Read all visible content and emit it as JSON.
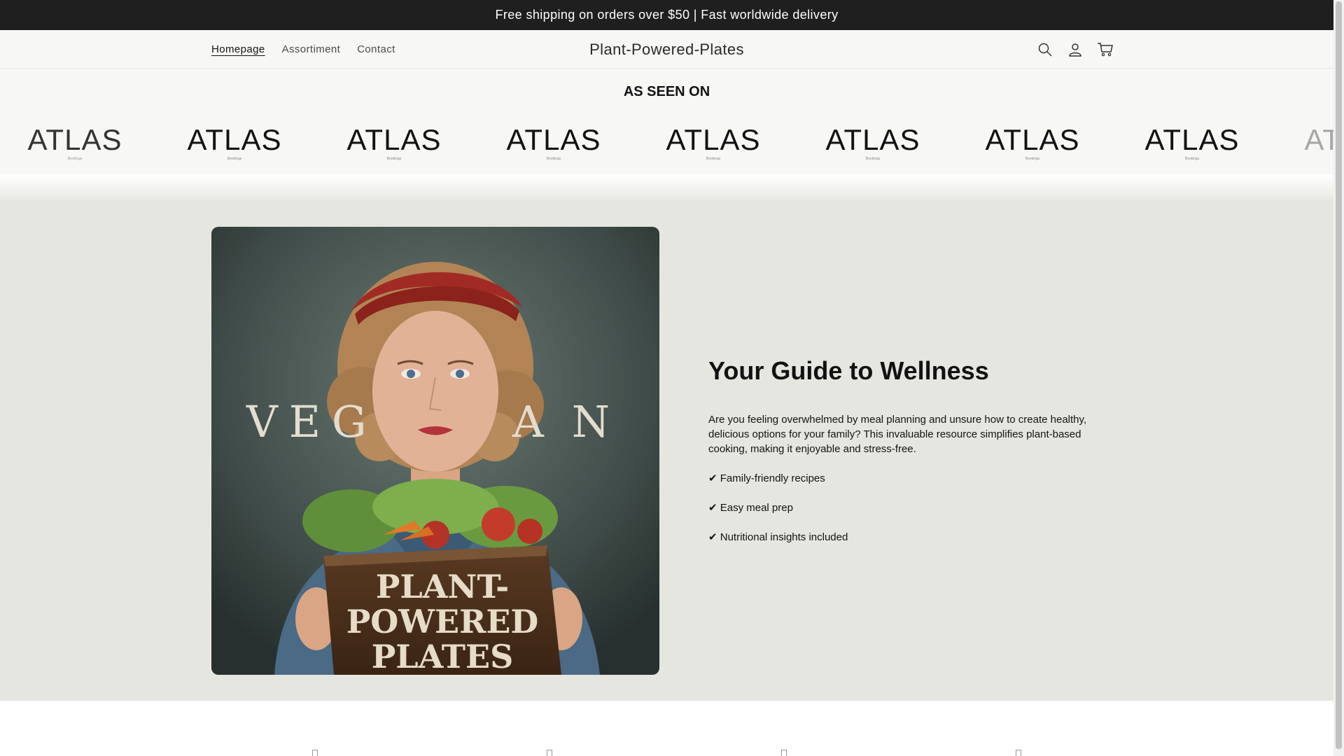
{
  "announcement": {
    "text": "Free shipping on orders over $50 | Fast worldwide delivery"
  },
  "header": {
    "nav": [
      {
        "label": "Homepage",
        "active": true
      },
      {
        "label": "Assortiment",
        "active": false
      },
      {
        "label": "Contact",
        "active": false
      }
    ],
    "brand": "Plant-Powered-Plates",
    "icons": [
      "search-icon",
      "account-icon",
      "cart-icon"
    ]
  },
  "seen_on": {
    "title": "AS SEEN ON",
    "logo_word": "ATLAS",
    "logo_tagline": "Bookings",
    "logo_count": 9
  },
  "hero": {
    "image": {
      "overlay_word_left": "VEG",
      "overlay_word_right": "AN",
      "book_line1": "PLANT-",
      "book_line2": "POWERED",
      "book_line3": "PLATES"
    },
    "heading": "Your Guide to Wellness",
    "body": "Are you feeling overwhelmed by meal planning and unsure how to create healthy, delicious options for your family? This invaluable resource simplifies plant-based cooking, making it enjoyable and stress-free.",
    "checks": [
      "✔ Family-friendly recipes",
      "✔ Easy meal prep",
      "✔ Nutritional insights included"
    ]
  },
  "colors": {
    "announcement_bg": "#1f1f1f",
    "header_bg": "#f7f7f5",
    "hero_bg": "#e6e6e0",
    "text": "#121212"
  }
}
